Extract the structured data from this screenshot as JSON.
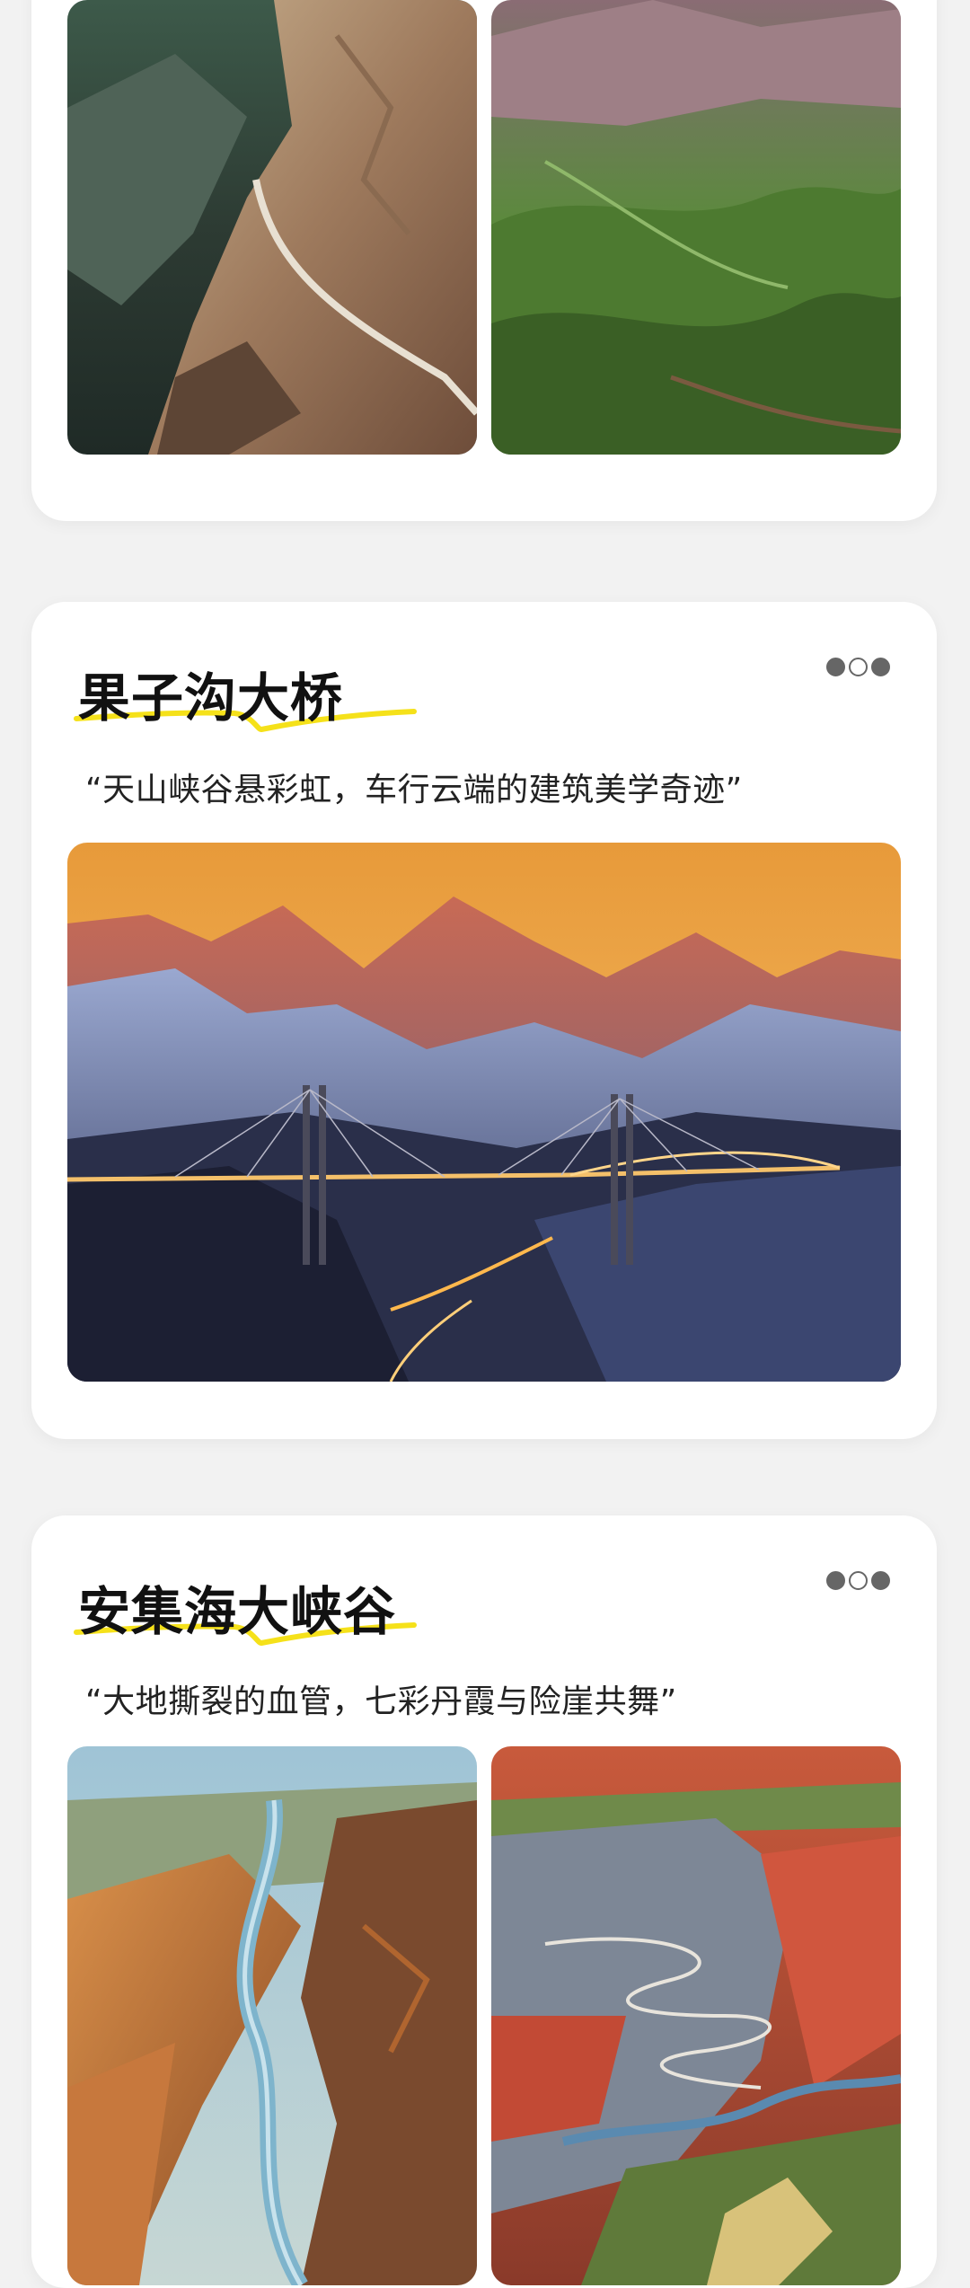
{
  "cards": [
    {
      "images": [
        {
          "alt": "cliff road"
        },
        {
          "alt": "green valleys"
        }
      ]
    },
    {
      "title": "果子沟大桥",
      "quote": "“天山峡谷悬彩虹，车行云端的建筑美学奇迹”",
      "pager": {
        "total": 3,
        "active": 2
      },
      "images": [
        {
          "alt": "bridge"
        }
      ]
    },
    {
      "title": "安集海大峡谷",
      "quote": "“大地撕裂的血管，七彩丹霞与险崖共舞”",
      "pager": {
        "total": 3,
        "active": 2
      },
      "images": [
        {
          "alt": "river canyon"
        },
        {
          "alt": "red canyon road"
        }
      ]
    }
  ],
  "colors": {
    "highlight": "#f5e11a",
    "dot": "#666666"
  }
}
